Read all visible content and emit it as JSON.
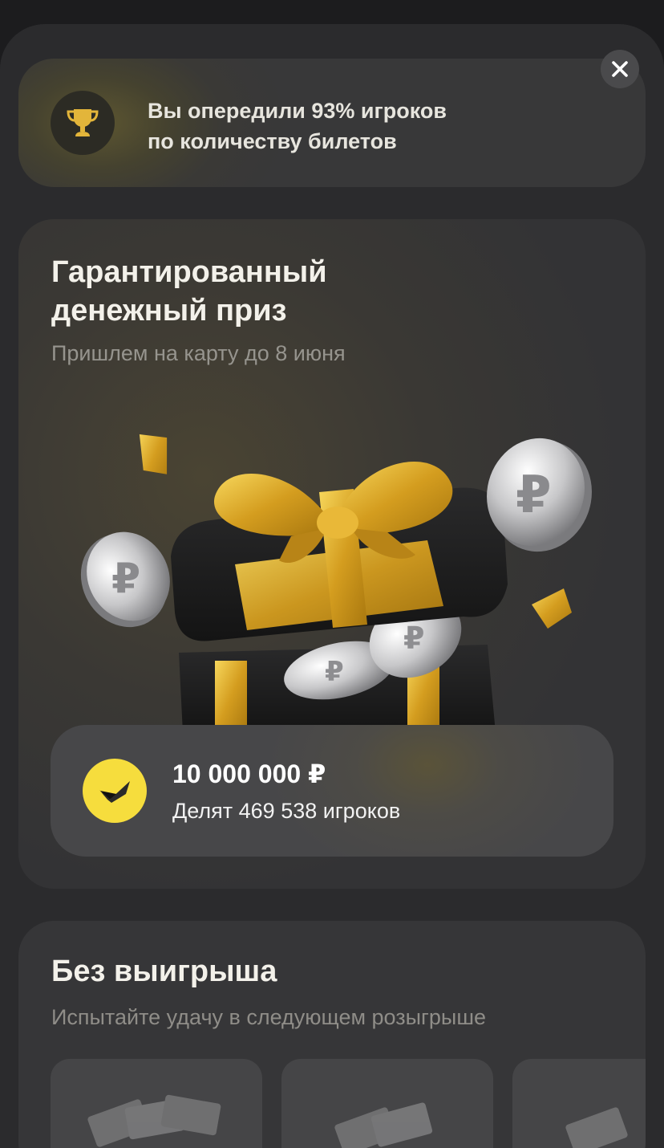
{
  "close": {
    "label": "Закрыть"
  },
  "rank": {
    "line1": "Вы опередили 93% игроков",
    "line2": "по количеству билетов",
    "percent": 93
  },
  "prize": {
    "title_line1": "Гарантированный",
    "title_line2": "денежный приз",
    "subtitle": "Пришлем на карту до 8 июня",
    "amount": "10 000 000 ₽",
    "share": "Делят 469 538 игроков"
  },
  "no_win": {
    "title": "Без выигрыша",
    "subtitle": "Испытайте удачу в следующем розыгрыше"
  },
  "icons": {
    "close": "close-icon",
    "trophy": "trophy-icon",
    "check": "check-icon"
  },
  "colors": {
    "accent_yellow": "#f6dd3d",
    "gold": "#d9a92a",
    "background": "#1c1c1e"
  }
}
